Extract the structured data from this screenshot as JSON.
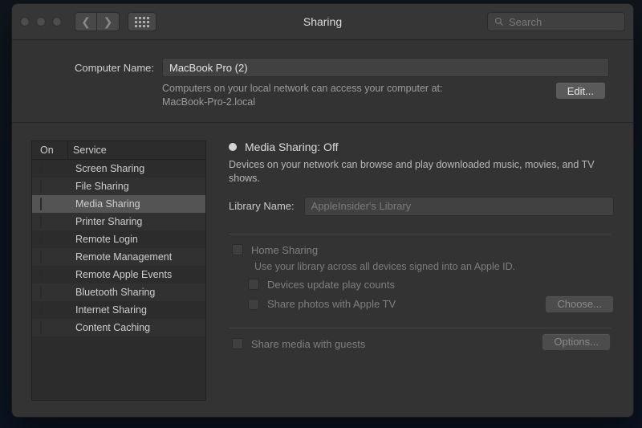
{
  "title": "Sharing",
  "search_placeholder": "Search",
  "computer_name": {
    "label": "Computer Name:",
    "value": "MacBook Pro (2)",
    "subtext_line1": "Computers on your local network can access your computer at:",
    "subtext_line2": "MacBook-Pro-2.local",
    "edit_button": "Edit..."
  },
  "services": {
    "col_on": "On",
    "col_service": "Service",
    "items": [
      {
        "label": "Screen Sharing"
      },
      {
        "label": "File Sharing"
      },
      {
        "label": "Media Sharing"
      },
      {
        "label": "Printer Sharing"
      },
      {
        "label": "Remote Login"
      },
      {
        "label": "Remote Management"
      },
      {
        "label": "Remote Apple Events"
      },
      {
        "label": "Bluetooth Sharing"
      },
      {
        "label": "Internet Sharing"
      },
      {
        "label": "Content Caching"
      }
    ]
  },
  "detail": {
    "status": "Media Sharing: Off",
    "description": "Devices on your network can browse and play downloaded music, movies, and TV shows.",
    "library_label": "Library Name:",
    "library_value": "AppleInsider's Library",
    "home_sharing": {
      "title": "Home Sharing",
      "desc": "Use your library across all devices signed into an Apple ID.",
      "opt_update": "Devices update play counts",
      "opt_photos": "Share photos with Apple TV",
      "choose_button": "Choose..."
    },
    "share_guests": {
      "label": "Share media with guests",
      "options_button": "Options..."
    }
  }
}
